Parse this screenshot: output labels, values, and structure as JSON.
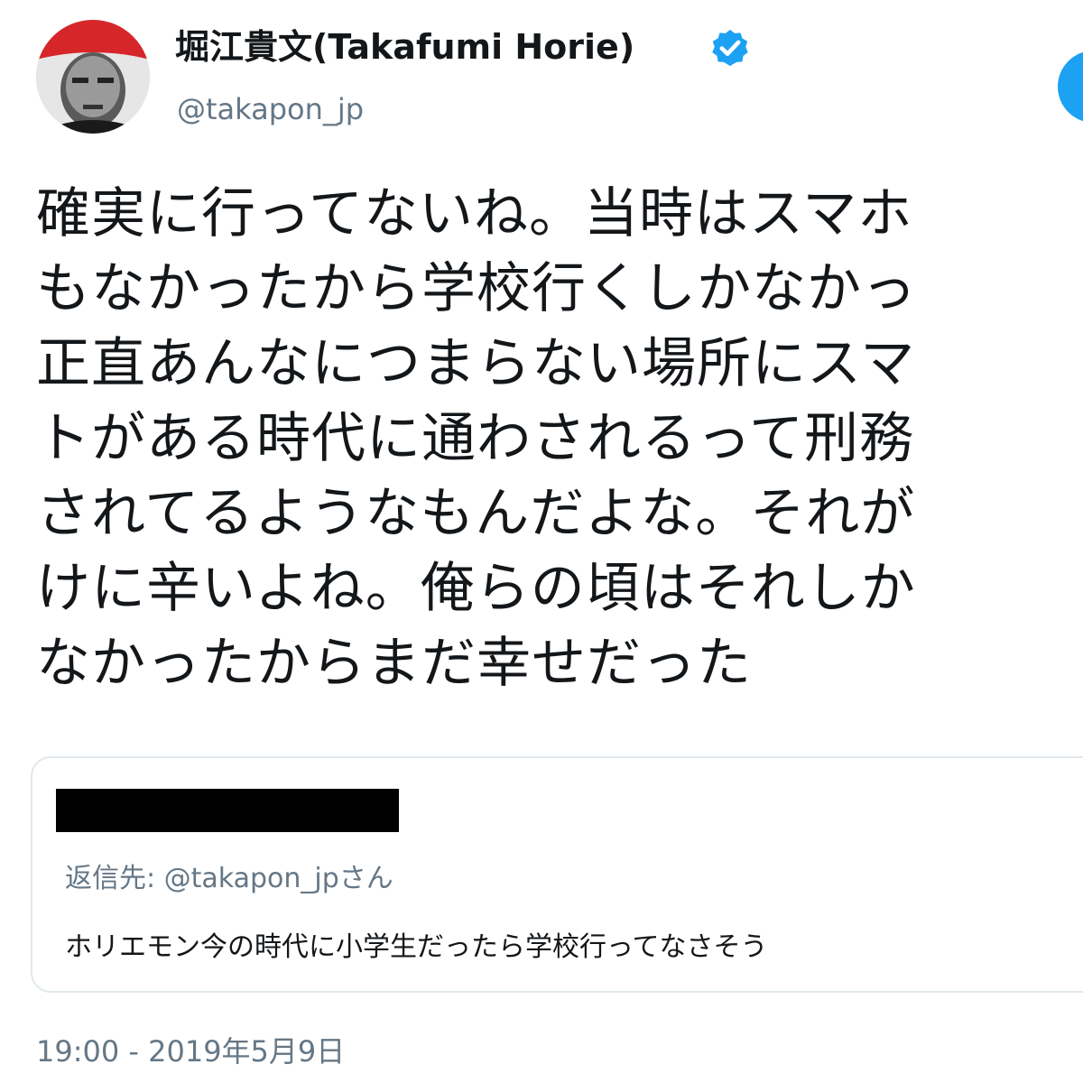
{
  "author": {
    "display_name": "堀江貴文(Takafumi Horie)",
    "handle": "@takapon_jp",
    "avatar_icon": "user-avatar",
    "verified_icon": "verified-badge-icon"
  },
  "tweet": {
    "lines": [
      "確実に行ってないね。当時はスマホ",
      "もなかったから学校行くしかなかっ",
      "正直あんなにつまらない場所にスマ",
      "トがある時代に通わされるって刑務",
      "されてるようなもんだよな。それが",
      "けに辛いよね。俺らの頃はそれしか",
      "なかったからまだ幸せだった"
    ],
    "timestamp": "19:00 - 2019年5月9日"
  },
  "quoted_tweet": {
    "reply_to": "返信先: @takapon_jpさん",
    "text": "ホリエモン今の時代に小学生だったら学校行ってなさそう"
  },
  "colors": {
    "accent": "#1da1f2",
    "secondary_text": "#657786",
    "border": "#e1e8ed",
    "avatar_red": "#d6262a"
  }
}
